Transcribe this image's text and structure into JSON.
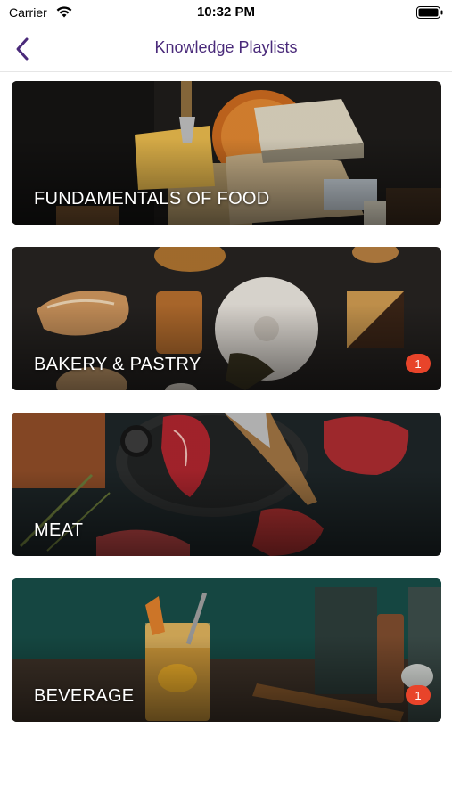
{
  "status_bar": {
    "carrier": "Carrier",
    "time": "10:32 PM"
  },
  "nav": {
    "title": "Knowledge Playlists"
  },
  "playlists": [
    {
      "title": "FUNDAMENTALS OF FOOD",
      "badge": null
    },
    {
      "title": "BAKERY & PASTRY",
      "badge": "1"
    },
    {
      "title": "MEAT",
      "badge": null
    },
    {
      "title": "BEVERAGE",
      "badge": "1"
    }
  ],
  "colors": {
    "accent": "#4a2a7a",
    "badge": "#e8442a"
  }
}
